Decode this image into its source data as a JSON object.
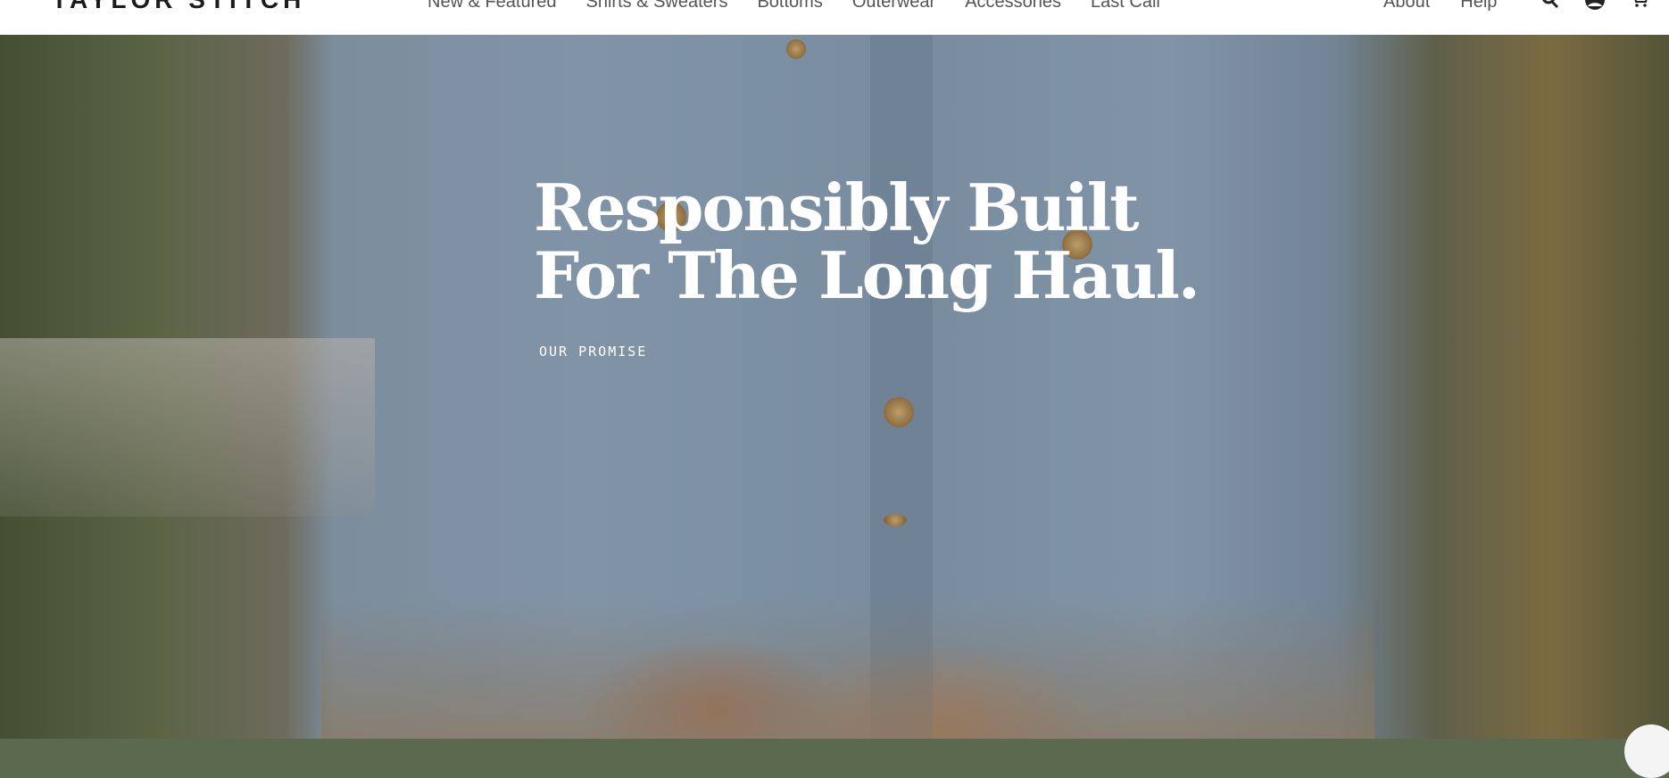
{
  "header": {
    "logo": "TAYLOR STITCH",
    "nav": [
      "New & Featured",
      "Shirts & Sweaters",
      "Bottoms",
      "Outerwear",
      "Accessories",
      "Last Call"
    ],
    "right_nav": [
      "About",
      "Help"
    ],
    "icons": [
      "search-icon",
      "account-icon",
      "cart-icon"
    ]
  },
  "hero": {
    "headline_line1": "Responsibly Built",
    "headline_line2": "For The Long Haul.",
    "cta": "OUR PROMISE"
  },
  "colors": {
    "header_bg": "#ffffff",
    "nav_text": "#555555",
    "hero_text": "#ffffff"
  }
}
